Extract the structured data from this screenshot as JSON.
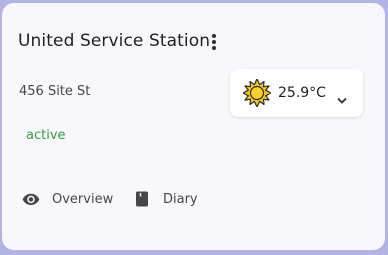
{
  "card": {
    "title": "United Service Station",
    "address": "456 Site St",
    "status": "active",
    "status_color": "#3a9a45"
  },
  "weather": {
    "temperature": "25.9°C",
    "icon": "sun-icon",
    "dropdown_icon": "chevron-down-icon"
  },
  "actions": {
    "overview_label": "Overview",
    "overview_icon": "eye-icon",
    "diary_label": "Diary",
    "diary_icon": "book-icon"
  },
  "menu_icon": "more-vertical-icon"
}
